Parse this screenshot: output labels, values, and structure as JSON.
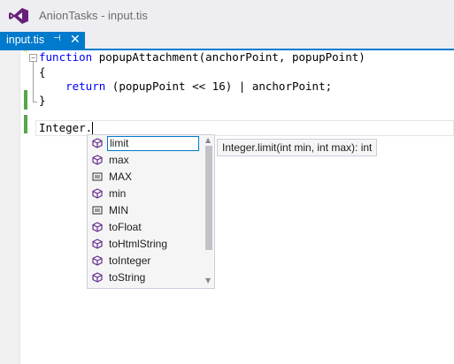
{
  "window": {
    "title": "AnionTasks - input.tis",
    "app_icon": "visual-studio-logo-icon",
    "accent_color": "#007acc"
  },
  "tab": {
    "label": "input.tis",
    "pin_icon": "⊣",
    "close_icon": "✕"
  },
  "editor": {
    "code": [
      {
        "kw": "function",
        "rest": " popupAttachment(anchorPoint, popupPoint)"
      },
      {
        "kw": "",
        "rest": "{"
      },
      {
        "kw": "return",
        "rest": " (popupPoint << 16) | anchorPoint;",
        "indent": "    "
      },
      {
        "kw": "",
        "rest": "}"
      },
      {
        "kw": "",
        "rest": ""
      },
      {
        "kw": "",
        "rest": "Integer."
      }
    ]
  },
  "completion": {
    "items": [
      {
        "label": "limit",
        "icon": "method-icon",
        "selected": true
      },
      {
        "label": "max",
        "icon": "method-icon"
      },
      {
        "label": "MAX",
        "icon": "constant-icon"
      },
      {
        "label": "min",
        "icon": "method-icon"
      },
      {
        "label": "MIN",
        "icon": "constant-icon"
      },
      {
        "label": "toFloat",
        "icon": "method-icon"
      },
      {
        "label": "toHtmlString",
        "icon": "method-icon"
      },
      {
        "label": "toInteger",
        "icon": "method-icon"
      },
      {
        "label": "toString",
        "icon": "method-icon"
      }
    ],
    "tooltip": "Integer.limit(int min, int max): int"
  }
}
